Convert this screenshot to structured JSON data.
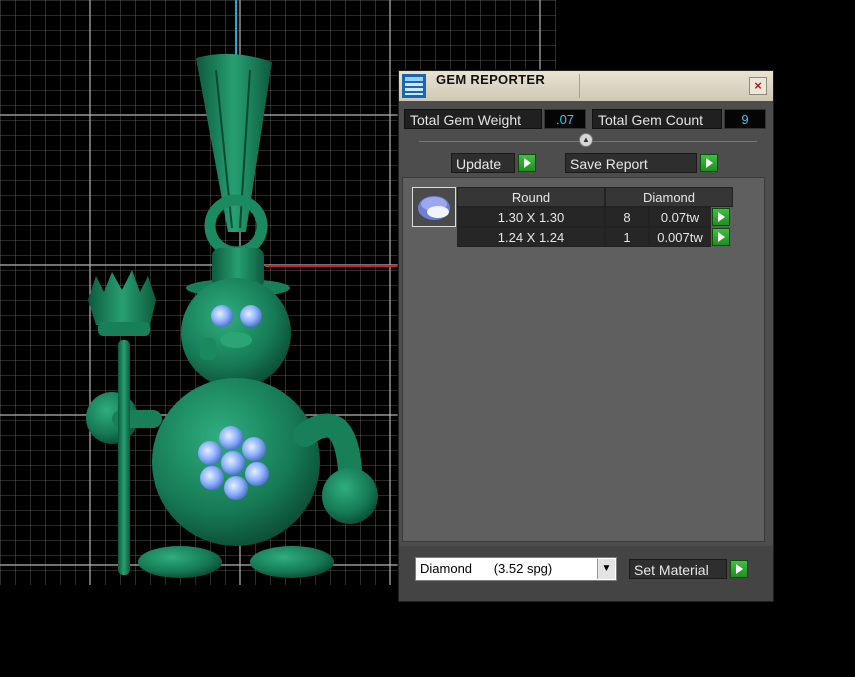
{
  "window": {
    "title": "GEM REPORTER",
    "close_icon": "close-icon"
  },
  "totals": {
    "weight_label": "Total Gem Weight",
    "weight_value": ".07",
    "count_label": "Total Gem Count",
    "count_value": "9"
  },
  "toolbar": {
    "update_label": "Update",
    "save_label": "Save Report"
  },
  "table": {
    "headers": [
      "Round",
      "Diamond"
    ],
    "rows": [
      {
        "size": "1.30 X 1.30",
        "count": "8",
        "weight": "0.07tw"
      },
      {
        "size": "1.24 X 1.24",
        "count": "1",
        "weight": "0.007tw"
      }
    ]
  },
  "material": {
    "selected": "Diamond      (3.52 spg)",
    "set_label": "Set Material"
  },
  "colors": {
    "model": "#1c8a62",
    "gems": "#8fb8ff",
    "grid": "#8a8a8a",
    "accent_value": "#35c5ff"
  }
}
